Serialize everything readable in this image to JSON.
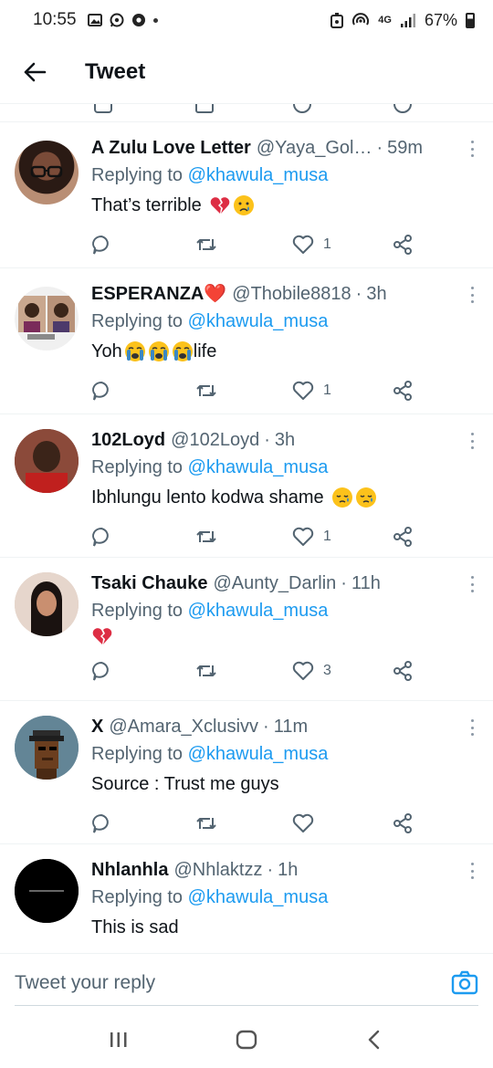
{
  "status_bar": {
    "time": "10:55",
    "network": "4G",
    "battery": "67%"
  },
  "header": {
    "title": "Tweet"
  },
  "colors": {
    "link": "#1d9bf0",
    "secondary_text": "#536471",
    "heart": "#e0245e"
  },
  "replies": [
    {
      "display_name": "A Zulu Love Letter",
      "handle": "@Yaya_Gol…",
      "age": "59m",
      "replying_prefix": "Replying to",
      "mention": "@khawula_musa",
      "text": "That’s terrible",
      "emojis": [
        "broken-heart",
        "crying-face"
      ],
      "likes": "1",
      "avatar": "woman-glasses"
    },
    {
      "display_name": "ESPERANZA❤️",
      "handle": "@Thobile8818",
      "age": "3h",
      "replying_prefix": "Replying to",
      "mention": "@khawula_musa",
      "text": "Yoh",
      "text_after": "life",
      "emojis": [
        "loudly-crying-face",
        "loudly-crying-face",
        "loudly-crying-face"
      ],
      "likes": "1",
      "avatar": "collage"
    },
    {
      "display_name": "102Loyd",
      "handle": "@102Loyd",
      "age": "3h",
      "replying_prefix": "Replying to",
      "mention": "@khawula_musa",
      "text": "Ibhlungu lento kodwa shame",
      "emojis": [
        "sad-tear-face",
        "sad-tear-face"
      ],
      "likes": "1",
      "avatar": "man-red-shirt"
    },
    {
      "display_name": "Tsaki Chauke",
      "handle": "@Aunty_Darlin",
      "age": "11h",
      "replying_prefix": "Replying to",
      "mention": "@khawula_musa",
      "text": "",
      "emojis": [
        "broken-heart"
      ],
      "likes": "3",
      "avatar": "woman-long-hair"
    },
    {
      "display_name": "X",
      "handle": "@Amara_Xclusivv",
      "age": "11m",
      "replying_prefix": "Replying to",
      "mention": "@khawula_musa",
      "text": "Source : Trust me guys",
      "emojis": [],
      "likes": "",
      "avatar": "pixel-punk"
    },
    {
      "display_name": "Nhlanhla",
      "handle": "@Nhlaktzz",
      "age": "1h",
      "replying_prefix": "Replying to",
      "mention": "@khawula_musa",
      "text": "This is sad",
      "emojis": [],
      "likes": "",
      "avatar": "black-logo"
    }
  ],
  "composer": {
    "placeholder": "Tweet your reply"
  }
}
